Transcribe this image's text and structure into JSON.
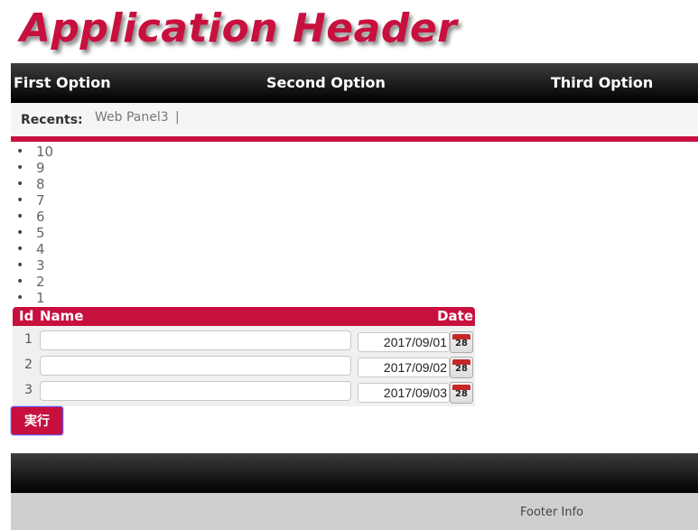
{
  "header": {
    "title": "Application Header"
  },
  "menu": {
    "items": [
      "First Option",
      "Second Option",
      "Third Option"
    ]
  },
  "recents": {
    "label": "Recents:",
    "items": [
      "Web Panel3"
    ],
    "separator": "|"
  },
  "list": {
    "items": [
      "10",
      "9",
      "8",
      "7",
      "6",
      "5",
      "4",
      "3",
      "2",
      "1"
    ]
  },
  "grid": {
    "columns": {
      "id": "Id",
      "name": "Name",
      "date": "Date"
    },
    "rows": [
      {
        "id": "1",
        "name": "",
        "date": "2017/09/01"
      },
      {
        "id": "2",
        "name": "",
        "date": "2017/09/02"
      },
      {
        "id": "3",
        "name": "",
        "date": "2017/09/03"
      }
    ],
    "calendar_icon_text": "28"
  },
  "actions": {
    "execute_label": "実行"
  },
  "footer": {
    "info": "Footer Info"
  },
  "colors": {
    "accent": "#c8103f",
    "menu_bg": "#000000",
    "footer_bg": "#cfcfcf"
  }
}
